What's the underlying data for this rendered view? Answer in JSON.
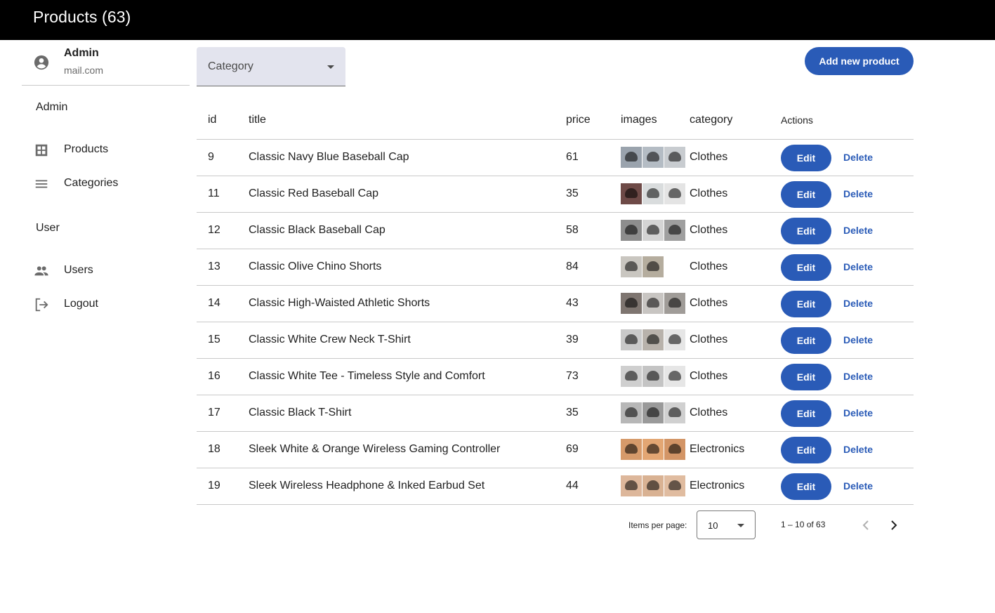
{
  "header": {
    "title": "Products  (63)"
  },
  "sidebar": {
    "profile": {
      "name": "Admin",
      "email": "mail.com",
      "icon": "account-circle-icon"
    },
    "sections": [
      {
        "title": "Admin",
        "items": [
          {
            "label": "Products",
            "icon": "grid-icon"
          },
          {
            "label": "Categories",
            "icon": "menu-icon"
          }
        ]
      },
      {
        "title": "User",
        "items": [
          {
            "label": "Users",
            "icon": "people-icon"
          },
          {
            "label": "Logout",
            "icon": "logout-icon"
          }
        ]
      }
    ]
  },
  "filter": {
    "label": "Category"
  },
  "toolbar": {
    "add_label": "Add new product"
  },
  "table": {
    "columns": [
      "id",
      "title",
      "price",
      "images",
      "category",
      "Actions"
    ],
    "edit_label": "Edit",
    "delete_label": "Delete",
    "rows": [
      {
        "id": "9",
        "title": "Classic Navy Blue Baseball Cap",
        "price": "61",
        "category": "Clothes",
        "thumbs": [
          "#9aa3ad",
          "#b4bcc4",
          "#c8ccd0"
        ]
      },
      {
        "id": "11",
        "title": "Classic Red Baseball Cap",
        "price": "35",
        "category": "Clothes",
        "thumbs": [
          "#6e4a47",
          "#d9dcdd",
          "#e4e4e4"
        ]
      },
      {
        "id": "12",
        "title": "Classic Black Baseball Cap",
        "price": "58",
        "category": "Clothes",
        "thumbs": [
          "#8d8d8d",
          "#d4d4d4",
          "#9f9f9f"
        ]
      },
      {
        "id": "13",
        "title": "Classic Olive Chino Shorts",
        "price": "84",
        "category": "Clothes",
        "thumbs": [
          "#c9c6c0",
          "#b5ad9e"
        ]
      },
      {
        "id": "14",
        "title": "Classic High-Waisted Athletic Shorts",
        "price": "43",
        "category": "Clothes",
        "thumbs": [
          "#7e7570",
          "#c8c5c2",
          "#a09c98"
        ]
      },
      {
        "id": "15",
        "title": "Classic White Crew Neck T-Shirt",
        "price": "39",
        "category": "Clothes",
        "thumbs": [
          "#c9c9c9",
          "#b8b2ab",
          "#e6e6e6"
        ]
      },
      {
        "id": "16",
        "title": "Classic White Tee - Timeless Style and Comfort",
        "price": "73",
        "category": "Clothes",
        "thumbs": [
          "#cfcfcf",
          "#c4c4c4",
          "#e6e6e6"
        ]
      },
      {
        "id": "17",
        "title": "Classic Black T-Shirt",
        "price": "35",
        "category": "Clothes",
        "thumbs": [
          "#b7b7b7",
          "#9a9a9a",
          "#d0d0d0"
        ]
      },
      {
        "id": "18",
        "title": "Sleek White & Orange Wireless Gaming Controller",
        "price": "69",
        "category": "Electronics",
        "thumbs": [
          "#d69a6a",
          "#e3a673",
          "#d39566"
        ]
      },
      {
        "id": "19",
        "title": "Sleek Wireless Headphone & Inked Earbud Set",
        "price": "44",
        "category": "Electronics",
        "thumbs": [
          "#ddb79b",
          "#d9b293",
          "#e0bca0"
        ]
      }
    ]
  },
  "paginator": {
    "items_per_page_label": "Items per page:",
    "page_size": "10",
    "range_label": "1 – 10 of 63",
    "prev_icon": "chevron-left-icon",
    "next_icon": "chevron-right-icon"
  },
  "colors": {
    "primary": "#2a5bb7",
    "topbar": "#000000",
    "select_bg": "#e3e4ee"
  }
}
